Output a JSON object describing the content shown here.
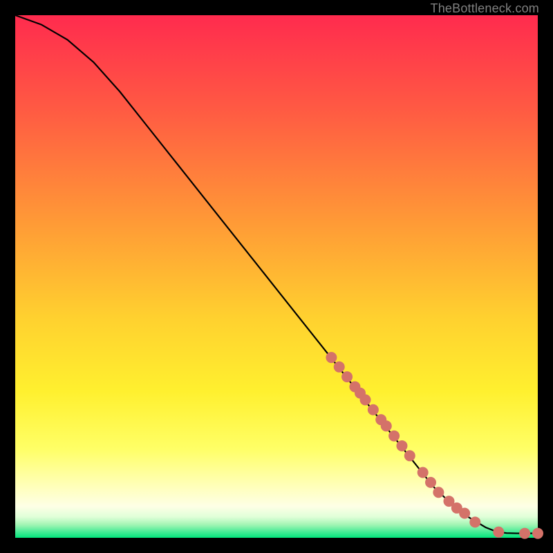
{
  "attribution": "TheBottleneck.com",
  "colors": {
    "gradient_top": "#ff2b4e",
    "gradient_mid_upper": "#ff8a3a",
    "gradient_mid": "#ffd831",
    "gradient_mid_lower": "#ffff55",
    "gradient_pale": "#ffffa8",
    "gradient_cream": "#fdffe0",
    "gradient_mint": "#9ff7b5",
    "gradient_green": "#02e57c",
    "curve_stroke": "#000000",
    "marker_fill": "#d47269",
    "page_bg": "#000000"
  },
  "chart_data": {
    "type": "line",
    "title": "",
    "xlabel": "",
    "ylabel": "",
    "xlim": [
      0,
      100
    ],
    "ylim": [
      0,
      100
    ],
    "series": [
      {
        "name": "curve",
        "x": [
          0,
          5,
          10,
          15,
          20,
          25,
          30,
          35,
          40,
          45,
          50,
          55,
          60,
          65,
          70,
          75,
          80,
          85,
          90,
          92,
          94,
          96,
          98,
          100
        ],
        "y": [
          100,
          98.2,
          95.3,
          91.0,
          85.4,
          79.1,
          72.8,
          66.5,
          60.2,
          53.9,
          47.6,
          41.3,
          35.0,
          28.7,
          22.4,
          16.1,
          9.8,
          5.0,
          2.0,
          1.2,
          0.9,
          0.85,
          0.85,
          0.85
        ]
      }
    ],
    "markers": {
      "name": "dots",
      "x": [
        60.5,
        62,
        63.5,
        65,
        66,
        67,
        68.5,
        70,
        71,
        72.5,
        74,
        75.5,
        78,
        79.5,
        81,
        83,
        84.5,
        86,
        88,
        92.5,
        97.5,
        100
      ],
      "y": [
        34.5,
        32.7,
        30.8,
        28.9,
        27.7,
        26.4,
        24.5,
        22.6,
        21.4,
        19.5,
        17.6,
        15.7,
        12.5,
        10.6,
        8.7,
        7.0,
        5.7,
        4.7,
        3.0,
        1.1,
        0.85,
        0.85
      ]
    }
  }
}
